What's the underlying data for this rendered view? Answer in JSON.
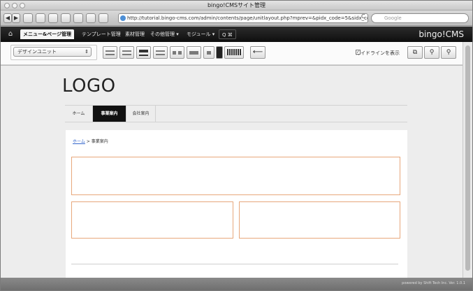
{
  "window": {
    "title": "bingo!CMSサイト管理"
  },
  "browser": {
    "back_glyph": "◀",
    "forward_glyph": "▶",
    "url": "http://tutorial.bingo-cms.com/admin/contents/page/unitlayout.php?mprev=&pidx_code=5&sidx_code=",
    "reload_glyph": "C",
    "search_placeholder": "Google"
  },
  "cms": {
    "home_glyph": "⌂",
    "tabs": [
      {
        "label": "メニュー&ページ管理"
      },
      {
        "label": "テンプレート管理"
      },
      {
        "label": "素材管理"
      },
      {
        "label": "その他管理 ▾"
      },
      {
        "label": "モジュール ▾"
      },
      {
        "label": "Q ⌘"
      }
    ],
    "brand": "bingo!CMS"
  },
  "design": {
    "select_value": "デザインユニット",
    "select_arrow": "⇕",
    "arrow_glyph": "⟵",
    "guide_label": "ガイドラインを表示",
    "guide_checkmark": "✓"
  },
  "page": {
    "logo": "LOGO",
    "nav": [
      {
        "label": "ホーム"
      },
      {
        "label": "事業案内"
      },
      {
        "label": "会社案内"
      }
    ],
    "breadcrumb": {
      "home": "ホーム",
      "separator": ">",
      "current": "事業案内"
    }
  },
  "status": {
    "text": "powered by Shift Tech Inc. Ver. 1.0.1"
  },
  "colors": {
    "box_border": "#e7a77b",
    "nav_active_bg": "#111111",
    "cms_bar_bg": "#1b1b1b",
    "link": "#3366cc"
  }
}
